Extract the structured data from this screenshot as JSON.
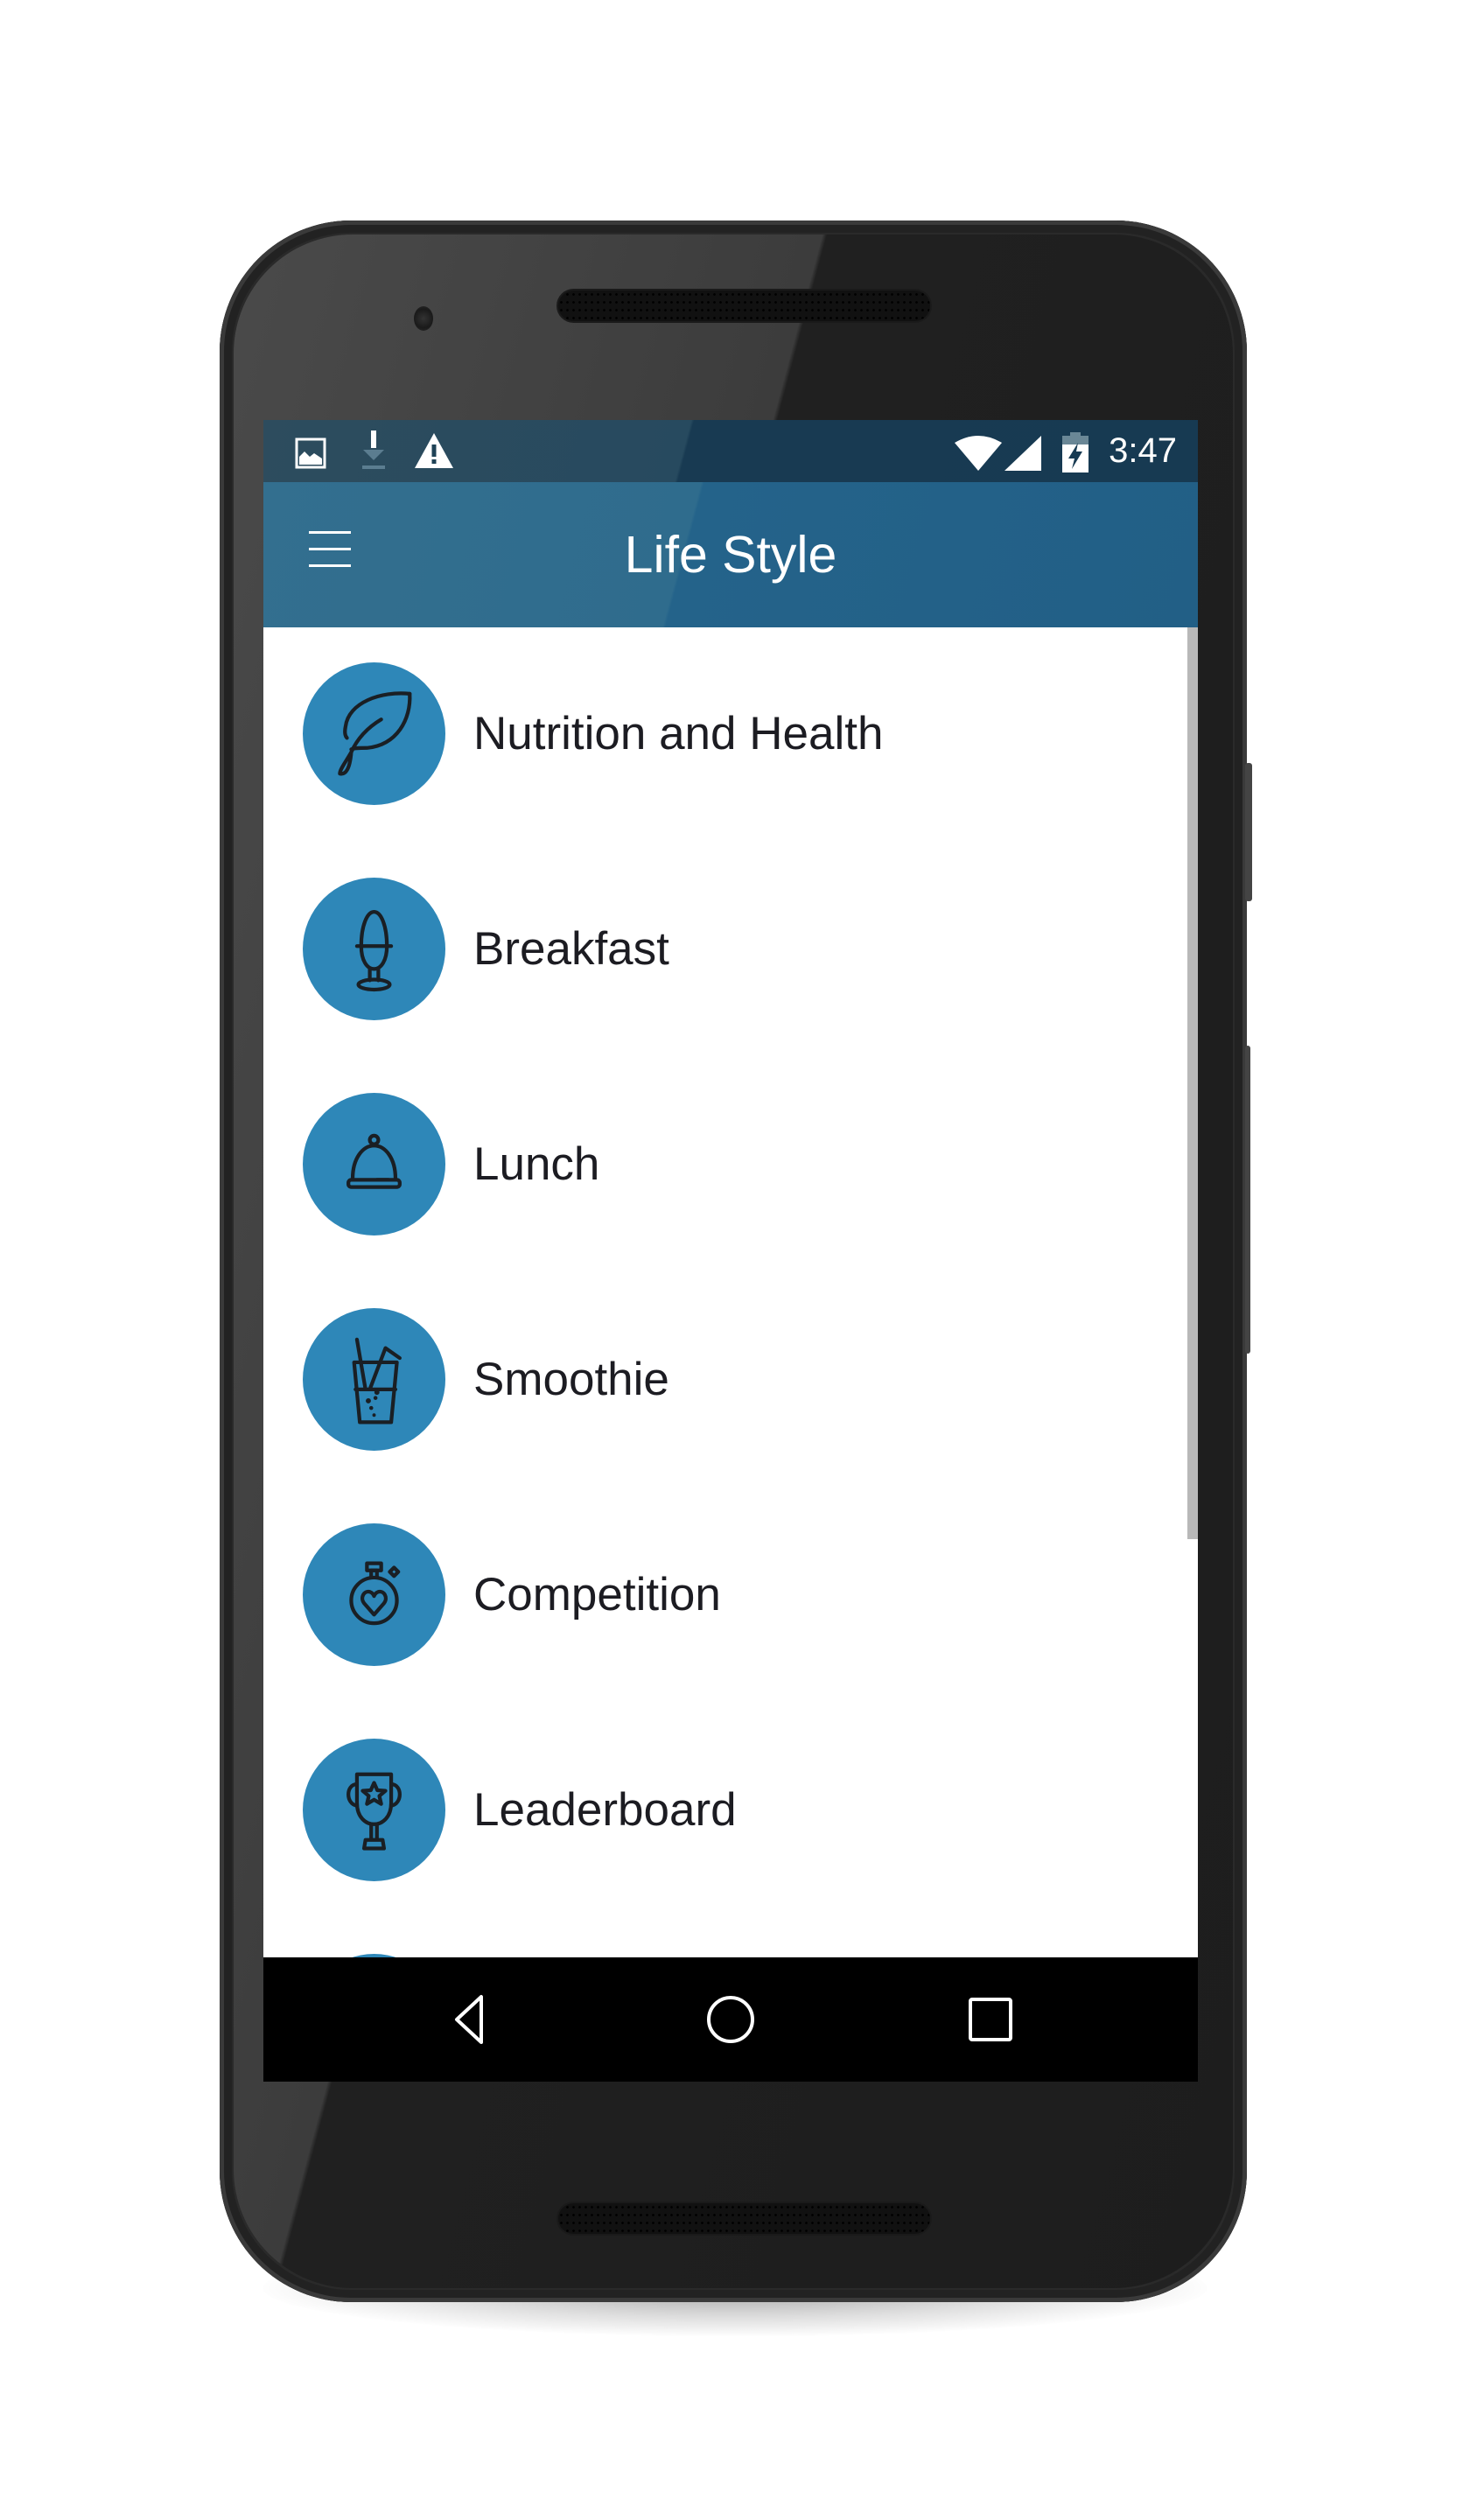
{
  "device": {
    "frame_color": "#2a2a2a"
  },
  "status_bar": {
    "left_icons": [
      "image-notification-icon",
      "download-icon",
      "warning-icon"
    ],
    "right_icons": [
      "wifi-icon",
      "cellular-signal-icon",
      "battery-charging-icon"
    ],
    "time": "3:47"
  },
  "app_bar": {
    "menu_icon": "hamburger-menu-icon",
    "title": "Life Style",
    "color": "#23638a"
  },
  "menu": {
    "icon_background": "#2e87b8",
    "items": [
      {
        "label": "Nutrition and Health",
        "icon": "leaf-icon"
      },
      {
        "label": "Breakfast",
        "icon": "egg-cup-icon"
      },
      {
        "label": "Lunch",
        "icon": "cloche-icon"
      },
      {
        "label": "Smoothie",
        "icon": "drink-glass-icon"
      },
      {
        "label": "Competition",
        "icon": "stopwatch-heart-icon"
      },
      {
        "label": "Leaderboard",
        "icon": "trophy-icon"
      }
    ]
  },
  "nav_bar": {
    "back": "back-icon",
    "home": "home-icon",
    "recents": "recents-icon"
  }
}
